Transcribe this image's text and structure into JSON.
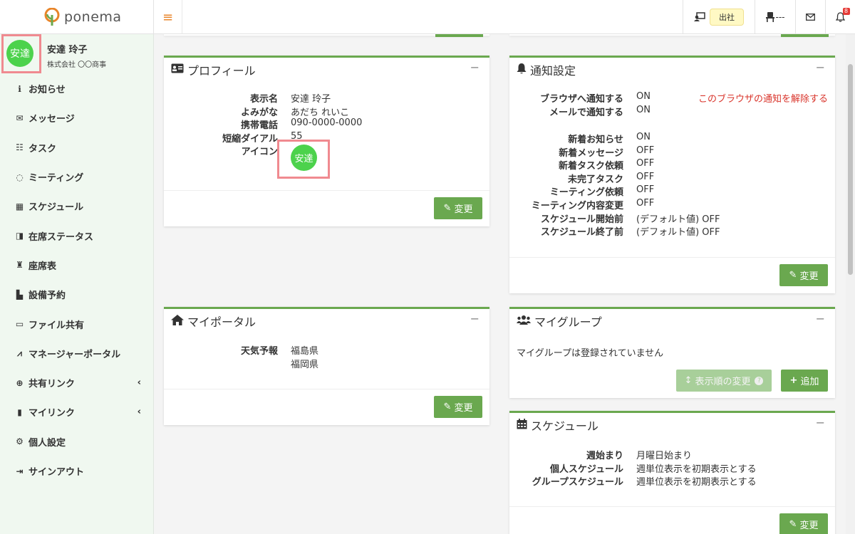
{
  "brand": {
    "name": "ponema"
  },
  "topbar": {
    "menu_icon": "hamburger-icon",
    "presence_label": "出社",
    "seat_label": "---",
    "notification_count": "8"
  },
  "user": {
    "avatar_text": "安達",
    "name": "安達 玲子",
    "company": "株式会社 〇〇商事"
  },
  "nav": [
    {
      "label": "お知らせ",
      "icon": "info-icon"
    },
    {
      "label": "メッセージ",
      "icon": "envelope-icon"
    },
    {
      "label": "タスク",
      "icon": "checklist-icon"
    },
    {
      "label": "ミーティング",
      "icon": "comments-icon"
    },
    {
      "label": "スケジュール",
      "icon": "calendar-icon"
    },
    {
      "label": "在席ステータス",
      "icon": "presence-icon"
    },
    {
      "label": "座席表",
      "icon": "chair-icon"
    },
    {
      "label": "設備予約",
      "icon": "door-icon"
    },
    {
      "label": "ファイル共有",
      "icon": "folder-icon"
    },
    {
      "label": "マネージャーポータル",
      "icon": "chart-icon"
    },
    {
      "label": "共有リンク",
      "icon": "globe-icon",
      "expand": "‹"
    },
    {
      "label": "マイリンク",
      "icon": "bookmark-icon",
      "expand": "‹"
    },
    {
      "label": "個人設定",
      "icon": "gear-icon"
    },
    {
      "label": "サインアウト",
      "icon": "signout-icon"
    }
  ],
  "profile": {
    "title": "プロフィール",
    "collapse": "−",
    "fields": [
      {
        "label": "表示名",
        "value": "安達 玲子"
      },
      {
        "label": "よみがな",
        "value": "あだち れいこ"
      },
      {
        "label": "携帯電話",
        "value": "090-0000-0000"
      },
      {
        "label": "短縮ダイアル",
        "value": "55"
      },
      {
        "label": "アイコン",
        "value": ""
      }
    ],
    "icon_avatar": "安達",
    "edit_label": "変更"
  },
  "portal": {
    "title": "マイポータル",
    "collapse": "−",
    "weather_label": "天気予報",
    "weather_values": [
      "福島県",
      "福岡県"
    ],
    "edit_label": "変更"
  },
  "notify": {
    "title": "通知設定",
    "collapse": "−",
    "rows_top": [
      {
        "label": "ブラウザへ通知する",
        "value": "ON"
      },
      {
        "label": "メールで通知する",
        "value": "ON"
      }
    ],
    "unsubscribe_link": "このブラウザの通知を解除する",
    "rows": [
      {
        "label": "新着お知らせ",
        "value": "ON"
      },
      {
        "label": "新着メッセージ",
        "value": "OFF"
      },
      {
        "label": "新着タスク依頼",
        "value": "OFF"
      },
      {
        "label": "未完了タスク",
        "value": "OFF"
      },
      {
        "label": "ミーティング依頼",
        "value": "OFF"
      },
      {
        "label": "ミーティング内容変更",
        "value": "OFF"
      },
      {
        "label": "スケジュール開始前",
        "value": "(デフォルト値) OFF"
      },
      {
        "label": "スケジュール終了前",
        "value": "(デフォルト値) OFF"
      }
    ],
    "edit_label": "変更"
  },
  "group": {
    "title": "マイグループ",
    "collapse": "−",
    "empty_text": "マイグループは登録されていません",
    "order_label": "表示順の変更",
    "add_label": "追加"
  },
  "schedule": {
    "title": "スケジュール",
    "collapse": "−",
    "rows": [
      {
        "label": "週始まり",
        "value": "月曜日始まり"
      },
      {
        "label": "個人スケジュール",
        "value": "週単位表示を初期表示とする"
      },
      {
        "label": "グループスケジュール",
        "value": "週単位表示を初期表示とする"
      }
    ],
    "edit_label": "変更"
  },
  "colors": {
    "accent": "#6aa84f",
    "sidebar_bg": "#f0f8f0",
    "avatar": "#4cd24c",
    "highlight": "#f08a90",
    "link_red": "#d9342b"
  }
}
